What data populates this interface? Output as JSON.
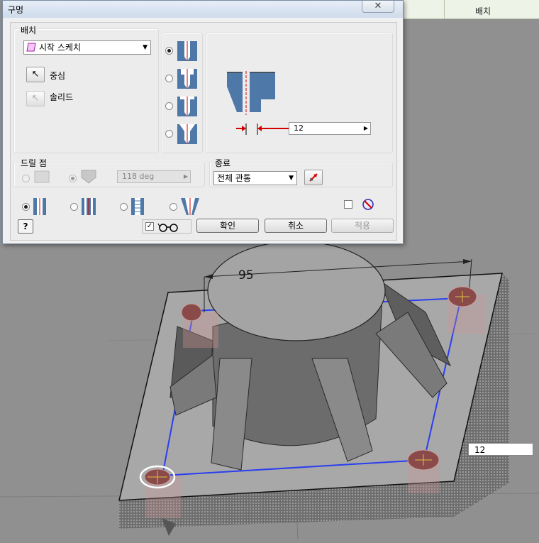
{
  "dialog": {
    "title": "구멍",
    "close_glyph": "✕",
    "placement": {
      "label": "배치",
      "combo_value": "시작 스케치",
      "center_label": "중심",
      "solid_label": "솔리드"
    },
    "drill_point": {
      "label": "드릴 점",
      "angle": "118 deg"
    },
    "termination": {
      "label": "종료",
      "combo_value": "전체 관통"
    },
    "preview": {
      "diameter_value": "12"
    },
    "buttons": {
      "ok": "확인",
      "cancel": "취소",
      "apply": "적용",
      "help": "?"
    },
    "icons": {
      "sketch": "sketch-plane-icon",
      "cursor": "select-cursor-icon",
      "flip": "flip-direction-icon",
      "glasses": "preview-glasses-icon",
      "no": "prohibit-icon"
    }
  },
  "viewport": {
    "dimension_text": "95",
    "value_input": "12",
    "background_header": "배치"
  },
  "colors": {
    "selection_blue": "#2a3ef0",
    "dimension_red": "#d40000",
    "section_blue": "#4d78a8"
  }
}
